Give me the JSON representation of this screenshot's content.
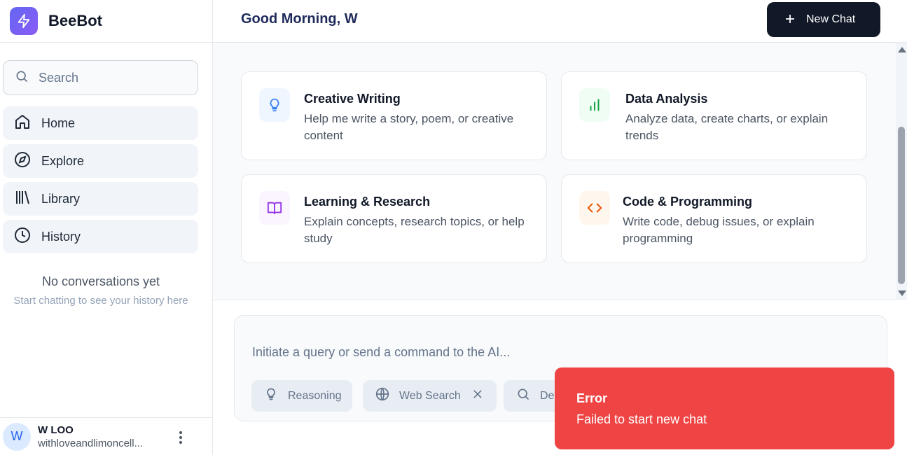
{
  "app": {
    "name": "BeeBot",
    "accent": "#6366f1"
  },
  "sidebar": {
    "search_placeholder": "Search",
    "items": [
      {
        "label": "Home",
        "icon": "home-icon"
      },
      {
        "label": "Explore",
        "icon": "compass-icon"
      },
      {
        "label": "Library",
        "icon": "library-icon"
      },
      {
        "label": "History",
        "icon": "clock-icon"
      }
    ],
    "empty_title": "No conversations yet",
    "empty_subtitle": "Start chatting to see your history here",
    "user": {
      "initial": "W",
      "name": "W LOO",
      "email": "withloveandlimoncell..."
    }
  },
  "header": {
    "greeting": "Good Morning, W",
    "new_chat_label": "New Chat"
  },
  "suggestions": [
    {
      "title": "Creative Writing",
      "description": "Help me write a story, poem, or creative content",
      "icon": "lightbulb-icon",
      "color": "#3b82f6",
      "bg": "#eff6ff"
    },
    {
      "title": "Data Analysis",
      "description": "Analyze data, create charts, or explain trends",
      "icon": "bar-chart-icon",
      "color": "#16a34a",
      "bg": "#f0fdf4"
    },
    {
      "title": "Learning & Research",
      "description": "Explain concepts, research topics, or help study",
      "icon": "book-icon",
      "color": "#9333ea",
      "bg": "#faf5ff"
    },
    {
      "title": "Code & Programming",
      "description": "Write code, debug issues, or explain programming",
      "icon": "code-icon",
      "color": "#ea580c",
      "bg": "#fff7ed"
    }
  ],
  "composer": {
    "placeholder": "Initiate a query or send a command to the AI...",
    "chips": [
      {
        "label": "Reasoning",
        "icon": "lightbulb-icon"
      },
      {
        "label": "Web Search",
        "icon": "globe-icon"
      },
      {
        "label": "De",
        "icon": "search-icon"
      }
    ]
  },
  "toast": {
    "title": "Error",
    "message": "Failed to start new chat",
    "color": "#ef4444"
  }
}
